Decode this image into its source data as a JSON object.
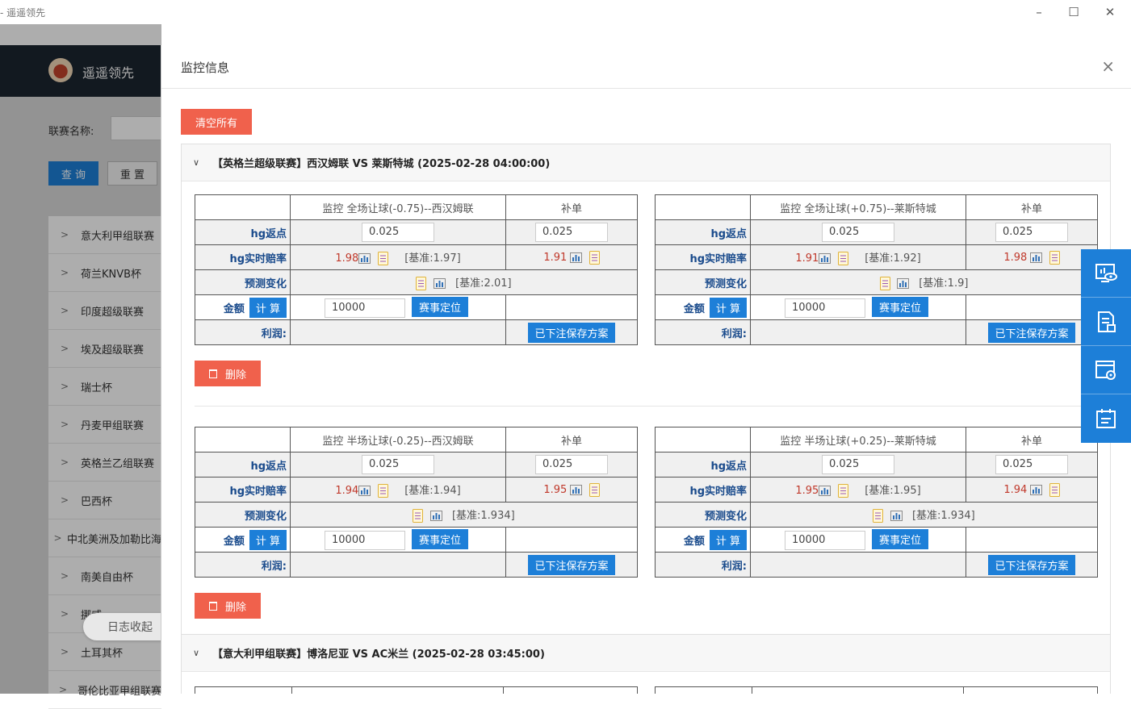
{
  "window": {
    "title": "- 遥遥领先",
    "minimize": "–",
    "maximize": "☐",
    "close": "✕"
  },
  "app": {
    "brand": "遥遥领先",
    "filter_label": "联赛名称:",
    "query_label": "查 询",
    "reset_label": "重 置",
    "leagues": [
      "意大利甲组联赛",
      "荷兰KNVB杯",
      "印度超级联赛",
      "埃及超级联赛",
      "瑞士杯",
      "丹麦甲组联赛",
      "英格兰乙组联赛",
      "巴西杯",
      "中北美洲及加勒比海",
      "南美自由杯",
      "挪威",
      "土耳其杯",
      "哥伦比亚甲组联赛"
    ],
    "log_collapse": "日志收起"
  },
  "modal": {
    "title": "监控信息",
    "close": "×",
    "clear_all": "清空所有",
    "delete_label": "删除",
    "row_labels": {
      "rebate": "hg返点",
      "live_odds": "hg实时赔率",
      "predict": "预测变化",
      "amount": "金额",
      "calc": "计 算",
      "profit": "利润:"
    },
    "col_extra": "补单",
    "locate_label": "赛事定位",
    "save_label": "已下注保存方案",
    "matches": [
      {
        "header": "【英格兰超级联赛】西汉姆联 VS 莱斯特城 (2025-02-28 04:00:00)",
        "tables": [
          {
            "title": "监控 全场让球(-0.75)--西汉姆联",
            "rebate": "0.025",
            "rebate_extra": "0.025",
            "odds": "1.98",
            "base": "[基准:1.97]",
            "odds_extra": "1.91",
            "predict_base": "[基准:2.01]",
            "amount": "10000"
          },
          {
            "title": "监控 全场让球(+0.75)--莱斯特城",
            "rebate": "0.025",
            "rebate_extra": "0.025",
            "odds": "1.91",
            "base": "[基准:1.92]",
            "odds_extra": "1.98",
            "predict_base": "[基准:1.9]",
            "amount": "10000"
          }
        ]
      },
      {
        "tables": [
          {
            "title": "监控 半场让球(-0.25)--西汉姆联",
            "rebate": "0.025",
            "rebate_extra": "0.025",
            "odds": "1.94",
            "base": "[基准:1.94]",
            "odds_extra": "1.95",
            "predict_base": "[基准:1.934]",
            "amount": "10000"
          },
          {
            "title": "监控 半场让球(+0.25)--莱斯特城",
            "rebate": "0.025",
            "rebate_extra": "0.025",
            "odds": "1.95",
            "base": "[基准:1.95]",
            "odds_extra": "1.94",
            "predict_base": "[基准:1.934]",
            "amount": "10000"
          }
        ]
      },
      {
        "header": "【意大利甲组联赛】博洛尼亚 VS AC米兰 (2025-02-28 03:45:00)"
      }
    ]
  },
  "float_icons": [
    "monitor-eye-icon",
    "document-list-icon",
    "browser-settings-icon",
    "calendar-icon"
  ],
  "colors": {
    "primary": "#1d7fd8",
    "danger": "#f0614c",
    "odds_red": "#c0392b",
    "label_blue": "#1a4b8c",
    "header_dark": "#1b2530"
  }
}
